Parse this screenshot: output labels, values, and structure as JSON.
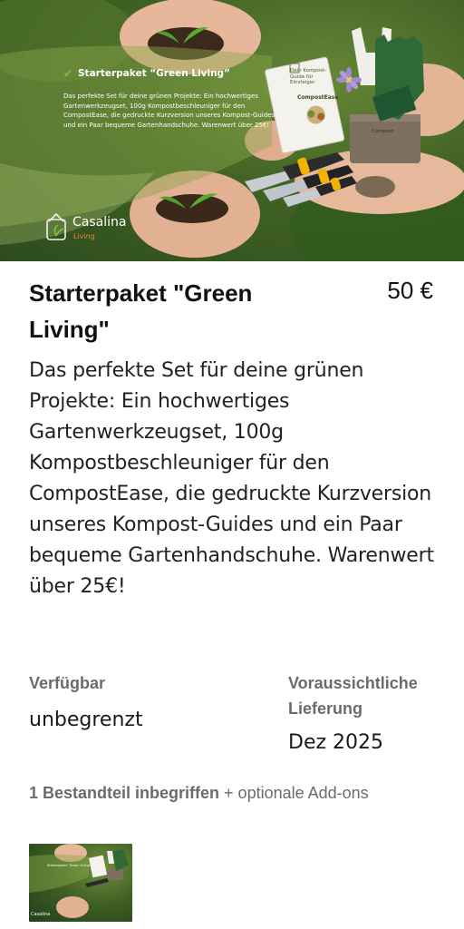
{
  "hero": {
    "check_icon": "check-icon",
    "title": "Starterpaket “Green Living”",
    "description": "Das perfekte Set für deine grünen Projekte: Ein hochwertiges Gartenwerkzeugset, 100g Kompostbeschleuniger für den CompostEase, die gedruckte Kurzversion unseres Kompost-Guides und ein Paar bequeme Gartenhandschuhe. Warenwert über 25€!",
    "book_title": "Dein Kompost-Guide für Einsteiger",
    "book_label": "CompostEase",
    "bag_label": "Compost",
    "logo_name": "Casalina",
    "logo_sub": "Living",
    "colors": {
      "check": "#7cc242",
      "logo_accent": "#e08a2a"
    }
  },
  "product": {
    "title": "Starterpaket \"Green Living\"",
    "price": "50 €",
    "description": "Das perfekte Set für deine grünen Projekte: Ein hochwertiges Gartenwerkzeugset, 100g Kompostbeschleuniger für den CompostEase, die gedruckte Kurzversion unseres Kompost-Guides und ein Paar bequeme Gartenhandschuhe. Warenwert über 25€!"
  },
  "availability": {
    "label": "Verfügbar",
    "value": "unbegrenzt"
  },
  "delivery": {
    "label": "Voraussichtliche Lieferung",
    "value": "Dez 2025"
  },
  "components": {
    "bold": "1 Bestandteil inbegriffen",
    "rest": " + optionale Add-ons"
  },
  "thumbnail": {
    "title": "Starterpaket “Green Living”",
    "logo": "Casalina"
  }
}
